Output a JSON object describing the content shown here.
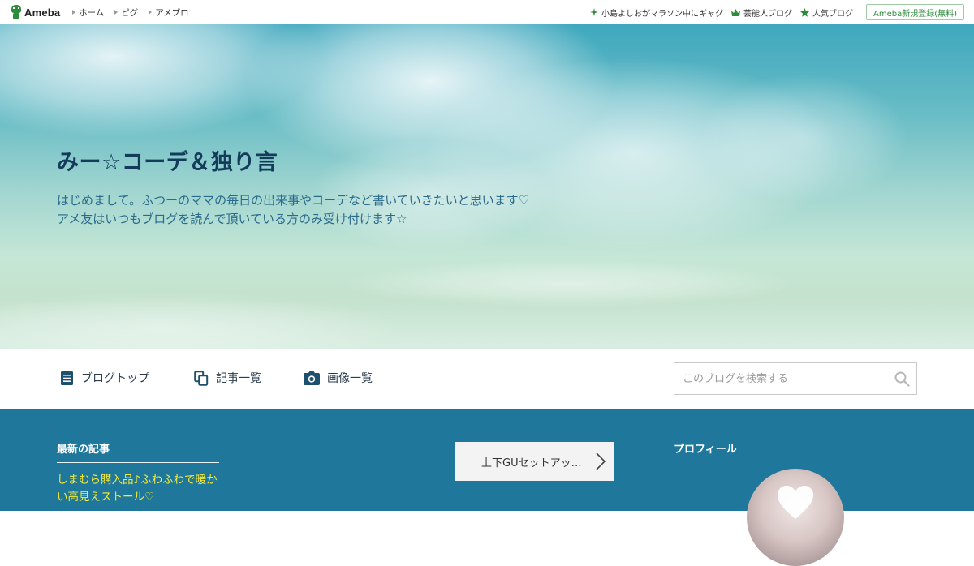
{
  "topbar": {
    "logo_text": "Ameba",
    "nav": [
      "ホーム",
      "ピグ",
      "アメブロ"
    ],
    "right_links": [
      {
        "label": "小島よしおがマラソン中にギャグ",
        "icon": "sparkle-icon"
      },
      {
        "label": "芸能人ブログ",
        "icon": "crown-icon"
      },
      {
        "label": "人気ブログ",
        "icon": "star-icon"
      }
    ],
    "register_label": "Ameba新規登録(無料)"
  },
  "hero": {
    "title": "みー☆コーデ＆独り言",
    "description_line1": "はじめまして。ふつーのママの毎日の出来事やコーデなど書いていきたいと思います♡",
    "description_line2": "アメ友はいつもブログを読んで頂いている方のみ受け付けます☆"
  },
  "blognav": {
    "items": [
      {
        "label": "ブログトップ",
        "icon": "document-icon"
      },
      {
        "label": "記事一覧",
        "icon": "copy-icon"
      },
      {
        "label": "画像一覧",
        "icon": "camera-icon"
      }
    ],
    "search_placeholder": "このブログを検索する"
  },
  "content": {
    "latest_title": "最新の記事",
    "latest_article": "しまむら購入品♪ふわふわで暖かい高見えストール♡",
    "card_label": "上下GUセットアッ…",
    "profile_title": "プロフィール"
  },
  "colors": {
    "brand_green": "#2d8c3c",
    "band_blue": "#1f789c",
    "title_navy": "#143c5a",
    "link_yellow": "#f3ea3a"
  }
}
